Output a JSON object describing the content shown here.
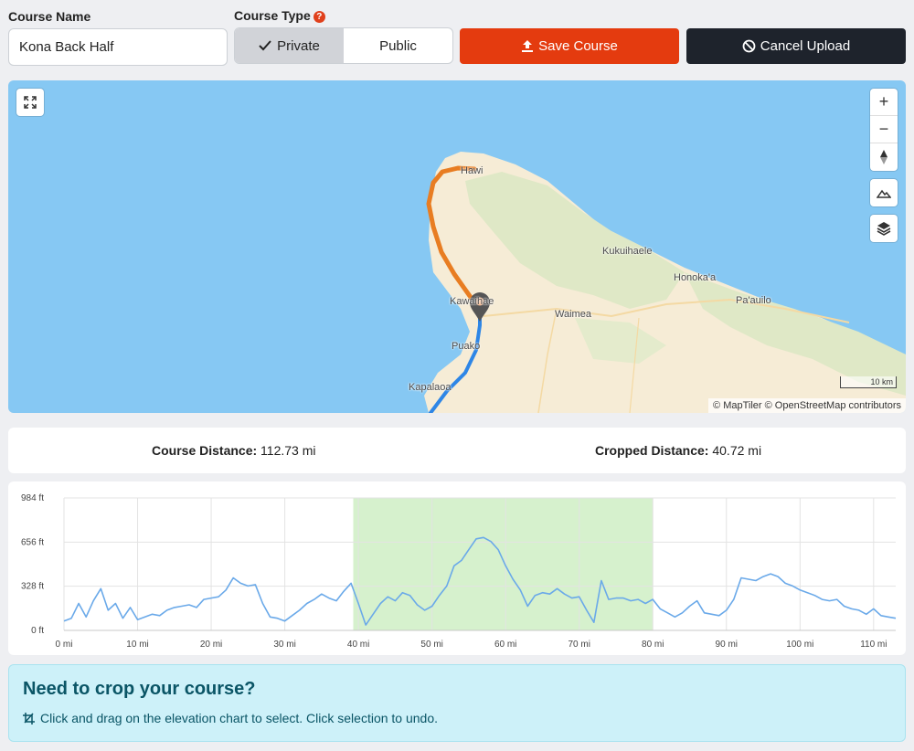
{
  "form": {
    "course_name_label": "Course Name",
    "course_name_value": "Kona Back Half",
    "course_type_label": "Course Type",
    "type_options": [
      "Private",
      "Public"
    ],
    "selected_type": "Private",
    "save_label": "Save Course",
    "cancel_label": "Cancel Upload"
  },
  "map": {
    "towns": [
      "Hawi",
      "Kukuihaele",
      "Honoka'a",
      "Pa'auilo",
      "Kawaihae",
      "Waimea",
      "Puako",
      "Kapalaoa"
    ],
    "scale_label": "10 km",
    "attribution": "© MapTiler © OpenStreetMap contributors",
    "controls": [
      "expand-icon",
      "zoom-in-icon",
      "zoom-out-icon",
      "compass-icon",
      "terrain-icon",
      "layers-icon"
    ],
    "colors": {
      "water": "#86c8f3",
      "land": "#f6ecd6",
      "route_main": "#2e86e6",
      "route_cropped": "#e87d22"
    }
  },
  "distances": {
    "course_label": "Course Distance:",
    "course_value": "112.73 mi",
    "cropped_label": "Cropped Distance:",
    "cropped_value": "40.72 mi"
  },
  "chart_data": {
    "type": "area",
    "title": "",
    "xlabel": "",
    "ylabel": "",
    "x_unit": "mi",
    "y_unit": "ft",
    "xlim": [
      0,
      113
    ],
    "ylim": [
      0,
      984
    ],
    "x_ticks": [
      0,
      10,
      20,
      30,
      40,
      50,
      60,
      70,
      80,
      90,
      100,
      110
    ],
    "y_ticks": [
      0,
      328,
      656,
      984
    ],
    "x_tick_labels": [
      "0 mi",
      "10 mi",
      "20 mi",
      "30 mi",
      "40 mi",
      "50 mi",
      "60 mi",
      "70 mi",
      "80 mi",
      "90 mi",
      "100 mi",
      "110 mi"
    ],
    "y_tick_labels": [
      "0 ft",
      "328 ft",
      "656 ft",
      "984 ft"
    ],
    "selection": [
      39.3,
      80
    ],
    "grid": true,
    "series": [
      {
        "x": [
          0,
          1,
          2,
          3,
          4,
          5,
          6,
          7,
          8,
          9,
          10,
          11,
          12,
          13,
          14,
          15,
          16,
          17,
          18,
          19,
          20,
          21,
          22,
          23,
          24,
          25,
          26,
          27,
          28,
          29,
          30,
          31,
          32,
          33,
          34,
          35,
          36,
          37,
          38,
          39,
          40,
          41,
          42,
          43,
          44,
          45,
          46,
          47,
          48,
          49,
          50,
          51,
          52,
          53,
          54,
          55,
          56,
          57,
          58,
          59,
          60,
          61,
          62,
          63,
          64,
          65,
          66,
          67,
          68,
          69,
          70,
          71,
          72,
          73,
          74,
          75,
          76,
          77,
          78,
          79,
          80,
          81,
          82,
          83,
          84,
          85,
          86,
          87,
          88,
          89,
          90,
          91,
          92,
          93,
          94,
          95,
          96,
          97,
          98,
          99,
          100,
          101,
          102,
          103,
          104,
          105,
          106,
          107,
          108,
          109,
          110,
          111,
          112,
          113
        ],
        "y": [
          70,
          90,
          200,
          100,
          220,
          310,
          150,
          200,
          90,
          170,
          80,
          100,
          120,
          110,
          150,
          170,
          180,
          190,
          170,
          230,
          240,
          250,
          300,
          390,
          350,
          330,
          340,
          200,
          100,
          90,
          70,
          110,
          150,
          200,
          230,
          270,
          240,
          220,
          290,
          350,
          200,
          40,
          120,
          200,
          250,
          220,
          280,
          260,
          190,
          150,
          180,
          260,
          330,
          480,
          520,
          600,
          680,
          690,
          660,
          600,
          480,
          380,
          300,
          180,
          260,
          280,
          270,
          310,
          270,
          240,
          250,
          150,
          60,
          370,
          230,
          240,
          240,
          220,
          230,
          200,
          230,
          160,
          130,
          100,
          130,
          180,
          220,
          130,
          120,
          110,
          150,
          230,
          390,
          380,
          370,
          400,
          420,
          400,
          350,
          330,
          300,
          280,
          260,
          230,
          220,
          230,
          180,
          160,
          150,
          120,
          160,
          110,
          100,
          90
        ]
      }
    ]
  },
  "crop_help": {
    "title": "Need to crop your course?",
    "text": "Click and drag on the elevation chart to select. Click selection to undo."
  }
}
